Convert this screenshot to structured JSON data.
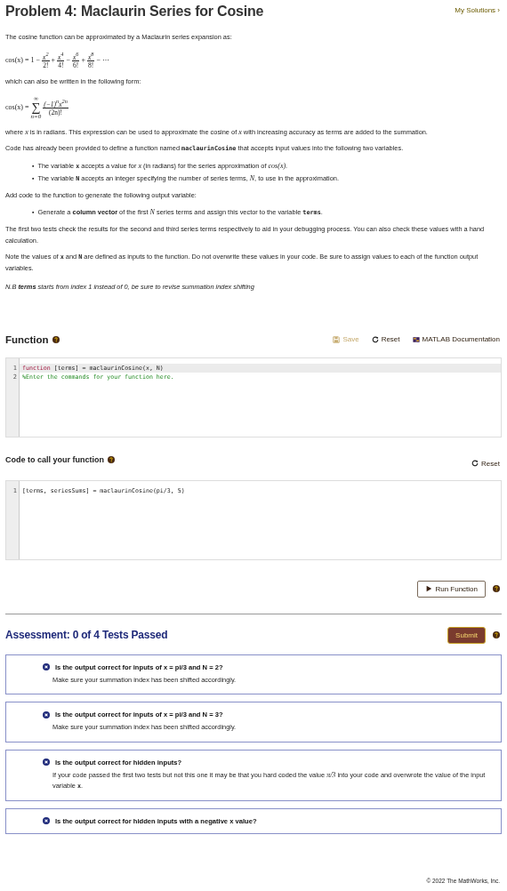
{
  "title": "Problem 4: Maclaurin Series for Cosine",
  "my_solutions": "My Solutions ›",
  "description": [
    {
      "kind": "paragraph",
      "segments": [
        {
          "kind": "text",
          "text": "The cosine function can be approximated by a Maclaurin series expansion as:"
        }
      ]
    },
    {
      "kind": "series",
      "lhs": "cos(x) =",
      "first": "1",
      "terms": [
        {
          "op": "−",
          "num": "x$^{2}$",
          "den": "2!"
        },
        {
          "op": "+",
          "num": "x$^{4}$",
          "den": "4!"
        },
        {
          "op": "−",
          "num": "x$^{6}$",
          "den": "6!"
        },
        {
          "op": "+",
          "num": "x$^{8}$",
          "den": "8!"
        }
      ],
      "tail": "− ⋯"
    },
    {
      "kind": "paragraph",
      "segments": [
        {
          "kind": "text",
          "text": "which can also be written in the following form:"
        }
      ]
    },
    {
      "kind": "sum",
      "lhs": "cos(x) =",
      "symbol": "∑",
      "upper": "∞",
      "lower": "n=0",
      "num": "(−1)$^{n}$x$^{2n}$",
      "den": "(2n)!"
    },
    {
      "kind": "paragraph",
      "segments": [
        {
          "kind": "text",
          "text": "where "
        },
        {
          "kind": "math",
          "text": "x"
        },
        {
          "kind": "text",
          "text": " is in radians. This expression can be used to approximate the cosine of "
        },
        {
          "kind": "math",
          "text": "x"
        },
        {
          "kind": "text",
          "text": " with increasing accuracy as terms are added to the summation."
        }
      ]
    },
    {
      "kind": "paragraph",
      "segments": [
        {
          "kind": "text",
          "text": "Code has already been provided to define a function named "
        },
        {
          "kind": "code",
          "text": "maclaurinCosine"
        },
        {
          "kind": "text",
          "text": " that accepts input values into the following two variables."
        }
      ]
    },
    {
      "kind": "bullets",
      "marker": "▪",
      "items": [
        [
          {
            "kind": "text",
            "text": "The variable "
          },
          {
            "kind": "code",
            "text": "x"
          },
          {
            "kind": "text",
            "text": " accepts a value for "
          },
          {
            "kind": "math",
            "text": "x"
          },
          {
            "kind": "text",
            "text": " (in radians) for the series approximation of "
          },
          {
            "kind": "math",
            "text": "cos(x)"
          },
          {
            "kind": "text",
            "text": "."
          }
        ],
        [
          {
            "kind": "text",
            "text": "The variable "
          },
          {
            "kind": "code",
            "text": "N"
          },
          {
            "kind": "text",
            "text": " accepts an integer specifying the number of series terms, "
          },
          {
            "kind": "math",
            "text": "N"
          },
          {
            "kind": "text",
            "text": ", to use in the approximation."
          }
        ]
      ]
    },
    {
      "kind": "paragraph",
      "segments": [
        {
          "kind": "text",
          "text": "Add code to the function to generate the following output variable:"
        }
      ]
    },
    {
      "kind": "bullets",
      "marker": "▪",
      "items": [
        [
          {
            "kind": "text",
            "text": "Generate a "
          },
          {
            "kind": "bold",
            "text": "column vector"
          },
          {
            "kind": "text",
            "text": " of the first "
          },
          {
            "kind": "math",
            "text": "N"
          },
          {
            "kind": "text",
            "text": " series terms and assign this vector to the variable "
          },
          {
            "kind": "code",
            "text": "terms"
          },
          {
            "kind": "text",
            "text": "."
          }
        ]
      ]
    },
    {
      "kind": "paragraph",
      "segments": [
        {
          "kind": "text",
          "text": "The first two tests check the results for the second and third series terms respectively to aid in your debugging process.  You can also check these values with a hand calculation."
        }
      ]
    },
    {
      "kind": "paragraph",
      "segments": [
        {
          "kind": "text",
          "text": "Note the values of "
        },
        {
          "kind": "code",
          "text": "x"
        },
        {
          "kind": "text",
          "text": " and "
        },
        {
          "kind": "code",
          "text": "N"
        },
        {
          "kind": "text",
          "text": "  are defined as inputs to the function.  Do not overwrite these values in your code.  Be sure to assign values to each of the function output variables."
        }
      ]
    },
    {
      "kind": "note",
      "segments": [
        {
          "kind": "text",
          "text": "N.B "
        },
        {
          "kind": "bold",
          "text": "terms"
        },
        {
          "kind": "text",
          "text": " starts from index 1 instead of 0, be sure to revise summation index shifting"
        }
      ]
    }
  ],
  "function_section": {
    "heading": "Function",
    "save": {
      "label": "Save",
      "disabled": true
    },
    "reset": "Reset",
    "docs": "MATLAB Documentation",
    "lines": [
      {
        "number": "1",
        "highlighted": true,
        "tokens": [
          {
            "kind": "keyword",
            "text": "function"
          },
          {
            "kind": "plain",
            "text": " [terms] = maclaurinCosine(x, N)"
          }
        ]
      },
      {
        "number": "2",
        "highlighted": false,
        "tokens": [
          {
            "kind": "comment",
            "text": "%Enter the commands for your function here."
          }
        ]
      }
    ]
  },
  "call_section": {
    "heading": "Code to call your function",
    "reset": "Reset",
    "lines": [
      {
        "number": "1",
        "highlighted": false,
        "tokens": [
          {
            "kind": "plain",
            "text": "[terms, seriesSums] = maclaurinCosine(pi/3, 5)"
          }
        ]
      }
    ],
    "run": "Run Function"
  },
  "assessment": {
    "heading": "Assessment: 0 of 4 Tests Passed",
    "submit": "Submit",
    "tests": [
      {
        "passed": false,
        "question": "Is the output correct for inputs of x = pi/3 and N = 2?",
        "message": [
          {
            "kind": "text",
            "text": "Make sure your summation index has been shifted accordingly."
          }
        ]
      },
      {
        "passed": false,
        "question": "Is the output correct for inputs of x = pi/3 and N = 3?",
        "message": [
          {
            "kind": "text",
            "text": "Make sure your summation index has been shifted accordingly."
          }
        ]
      },
      {
        "passed": false,
        "question": "Is the output correct for hidden inputs?",
        "message": [
          {
            "kind": "text",
            "text": "If your code passed the first two tests but not this one it may be that you hard coded the value "
          },
          {
            "kind": "math",
            "text": "π/3"
          },
          {
            "kind": "text",
            "text": " into your code and overwrote the value of the input variable "
          },
          {
            "kind": "code",
            "text": "x"
          },
          {
            "kind": "text",
            "text": "."
          }
        ]
      },
      {
        "passed": false,
        "question": "Is the output correct for hidden inputs with a negative x value?"
      }
    ]
  },
  "footer": "© 2022 The MathWorks, Inc."
}
